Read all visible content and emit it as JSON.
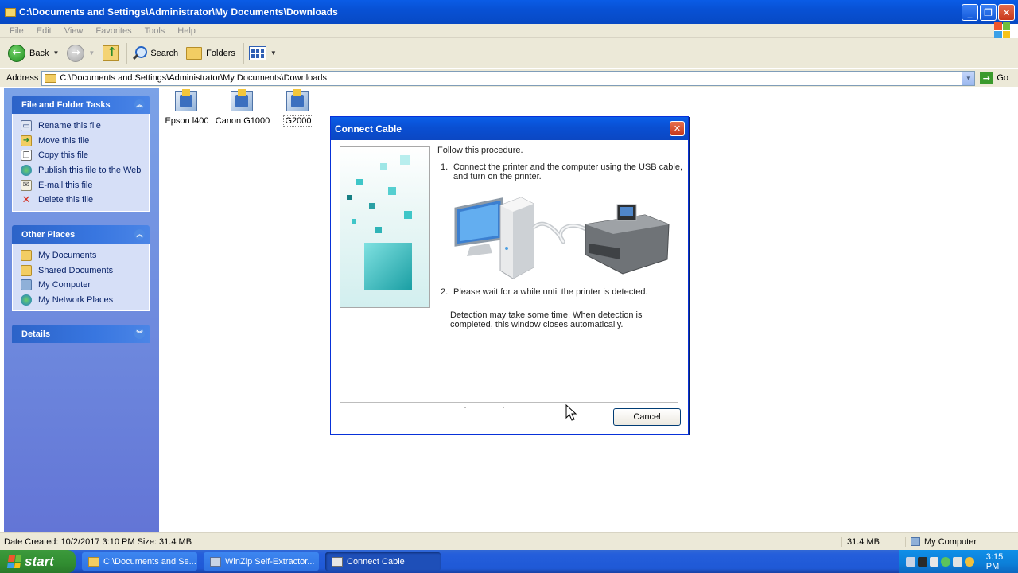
{
  "window": {
    "title": "C:\\Documents and Settings\\Administrator\\My Documents\\Downloads"
  },
  "menu": [
    "File",
    "Edit",
    "View",
    "Favorites",
    "Tools",
    "Help"
  ],
  "toolbar": {
    "back_label": "Back",
    "search_label": "Search",
    "folders_label": "Folders"
  },
  "address": {
    "label": "Address",
    "value": "C:\\Documents and Settings\\Administrator\\My Documents\\Downloads",
    "go_label": "Go"
  },
  "taskpane": {
    "file_tasks": {
      "title": "File and Folder Tasks",
      "items": [
        {
          "label": "Rename this file",
          "icon": "rename-icon"
        },
        {
          "label": "Move this file",
          "icon": "move-icon"
        },
        {
          "label": "Copy this file",
          "icon": "copy-icon"
        },
        {
          "label": "Publish this file to the Web",
          "icon": "globe-icon"
        },
        {
          "label": "E-mail this file",
          "icon": "email-icon"
        },
        {
          "label": "Delete this file",
          "icon": "delete-icon"
        }
      ]
    },
    "other_places": {
      "title": "Other Places",
      "items": [
        {
          "label": "My Documents",
          "icon": "my-documents-icon"
        },
        {
          "label": "Shared Documents",
          "icon": "folder-icon"
        },
        {
          "label": "My Computer",
          "icon": "computer-icon"
        },
        {
          "label": "My Network Places",
          "icon": "network-icon"
        }
      ]
    },
    "details": {
      "title": "Details"
    }
  },
  "files": [
    {
      "name": "Epson l400",
      "selected": false
    },
    {
      "name": "Canon G1000",
      "selected": false
    },
    {
      "name": "G2000",
      "selected": true
    }
  ],
  "dialog": {
    "title": "Connect Cable",
    "intro": "Follow this procedure.",
    "step1_num": "1.",
    "step1_text": "Connect the printer and the computer using the USB cable, and turn on the printer.",
    "step2_num": "2.",
    "step2_text": "Please wait for a while until the printer is detected.",
    "note": "Detection may take some time. When detection is completed, this window closes automatically.",
    "cancel_label": "Cancel"
  },
  "statusbar": {
    "left": "Date Created: 10/2/2017 3:10 PM Size: 31.4 MB",
    "size": "31.4 MB",
    "location": "My Computer"
  },
  "taskbar": {
    "start_label": "start",
    "buttons": [
      {
        "label": "C:\\Documents and Se...",
        "active": false
      },
      {
        "label": "WinZip Self-Extractor...",
        "active": false
      },
      {
        "label": "Connect Cable",
        "active": true
      }
    ],
    "clock": "3:15 PM"
  },
  "colors": {
    "title_blue": "#0a5ce6",
    "taskpane_blue": "#7ba2e7",
    "start_green": "#3c9a3c",
    "tray_blue": "#0f8fe8",
    "cube_teal": "#3fc6c8"
  }
}
